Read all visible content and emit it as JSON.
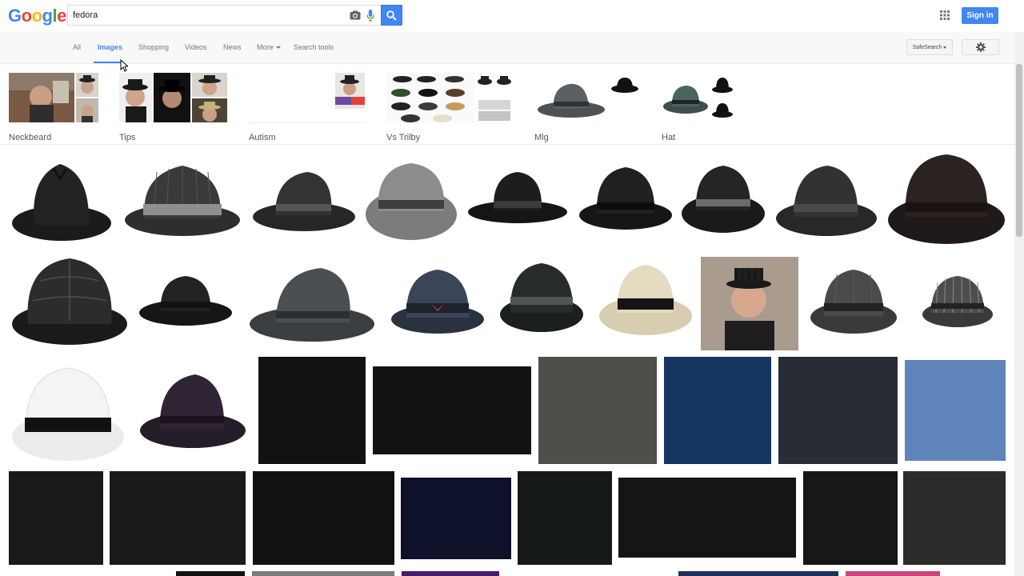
{
  "header": {
    "logo": {
      "letters": [
        "G",
        "o",
        "o",
        "g",
        "l",
        "e"
      ],
      "colors": [
        "#4285f4",
        "#ea4335",
        "#fbbc05",
        "#4285f4",
        "#34a853",
        "#ea4335"
      ]
    },
    "search": {
      "value": "fedora"
    },
    "signin_label": "Sign in"
  },
  "nav": {
    "tabs": [
      {
        "label": "All"
      },
      {
        "label": "Images"
      },
      {
        "label": "Shopping"
      },
      {
        "label": "Videos"
      },
      {
        "label": "News"
      },
      {
        "label": "More"
      },
      {
        "label": "Search tools"
      }
    ],
    "safesearch_label": "SafeSearch"
  },
  "related": [
    {
      "label": "Neckbeard"
    },
    {
      "label": "Tips"
    },
    {
      "label": "Autism"
    },
    {
      "label": "Vs Trilby"
    },
    {
      "label": "Mlg"
    },
    {
      "label": "Hat"
    }
  ],
  "colors": {
    "accent": "#4285f4"
  }
}
